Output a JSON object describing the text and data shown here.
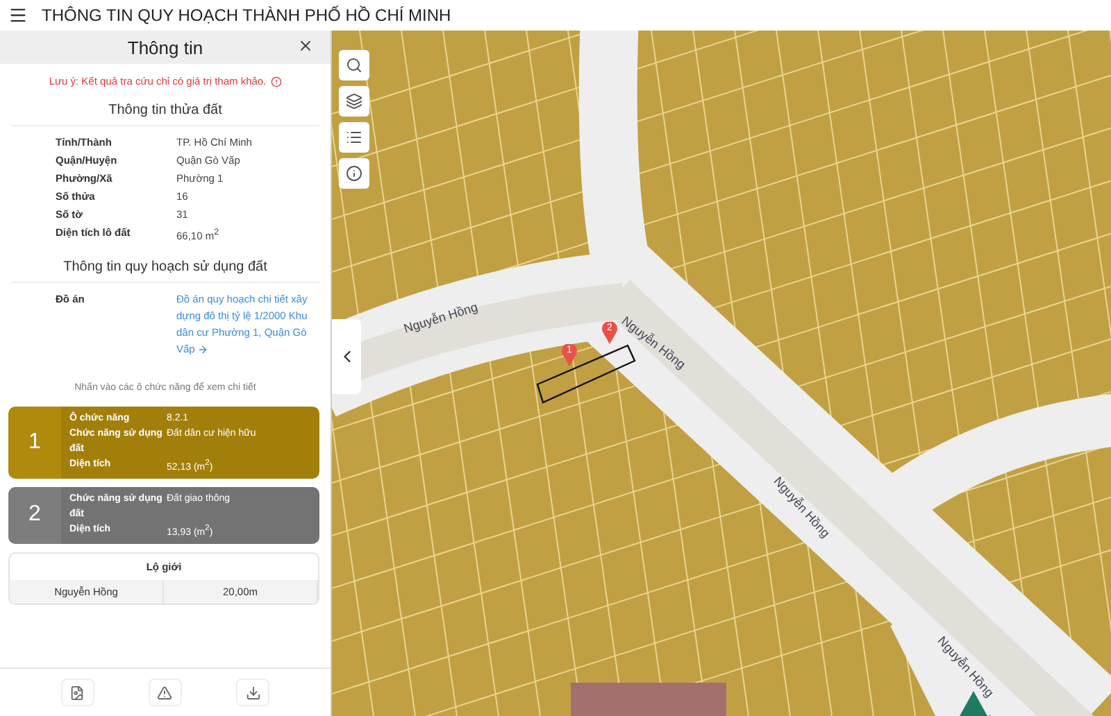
{
  "app_title": "THÔNG TIN QUY HOẠCH THÀNH PHỐ HỒ CHÍ MINH",
  "panel": {
    "title": "Thông tin",
    "note": "Lưu ý: Kết quả tra cứu chỉ có giá trị tham khảo.",
    "parcel_section": {
      "heading": "Thông tin thửa đất",
      "rows": [
        {
          "label": "Tỉnh/Thành",
          "value": "TP. Hồ Chí Minh"
        },
        {
          "label": "Quận/Huyện",
          "value": "Quận Gò Vấp"
        },
        {
          "label": "Phường/Xã",
          "value": "Phường 1"
        },
        {
          "label": "Số thửa",
          "value": "16"
        },
        {
          "label": "Số tờ",
          "value": "31"
        },
        {
          "label": "Diện tích lô đất",
          "value": "66,10 m$^{2}$"
        }
      ]
    },
    "planning_section": {
      "heading": "Thông tin quy hoạch sử dụng đất",
      "rows": [
        {
          "label": "Đồ án",
          "value": "Đồ án quy hoạch chi tiết xây dựng đô thị tỷ lệ 1/2000 Khu dân cư Phường 1, Quận Gò Vấp",
          "kind": "link"
        }
      ]
    },
    "hint": "Nhấn vào các ô chức năng để xem chi tiết",
    "zones": [
      {
        "number": "1",
        "color": "#b08a0c",
        "rows": [
          {
            "label": "Ô chức năng",
            "value": "8.2.1"
          },
          {
            "label": "Chức năng sử dụng đất",
            "value": "Đất dân cư hiện hữu"
          },
          {
            "label": "Diện tích",
            "value": "52,13 (m$^{2}$)"
          }
        ]
      },
      {
        "number": "2",
        "color": "#7d7d7d",
        "rows": [
          {
            "label": "Chức năng sử dụng đất",
            "value": "Đất giao thông"
          },
          {
            "label": "Diện tích",
            "value": "13,93 (m$^{2}$)"
          }
        ]
      }
    ],
    "boundary": {
      "heading": "Lộ giới",
      "rows": [
        {
          "street": "Nguyễn Hồng",
          "width": "20,00m"
        }
      ]
    }
  },
  "map": {
    "road_labels": [
      {
        "text": "Nguyễn Hồng"
      },
      {
        "text": "Nguyễn Hồng"
      },
      {
        "text": "Nguyễn Hồng"
      },
      {
        "text": "Nguyễn Hồng"
      }
    ],
    "markers": [
      {
        "label": "1"
      },
      {
        "label": "2"
      }
    ]
  }
}
